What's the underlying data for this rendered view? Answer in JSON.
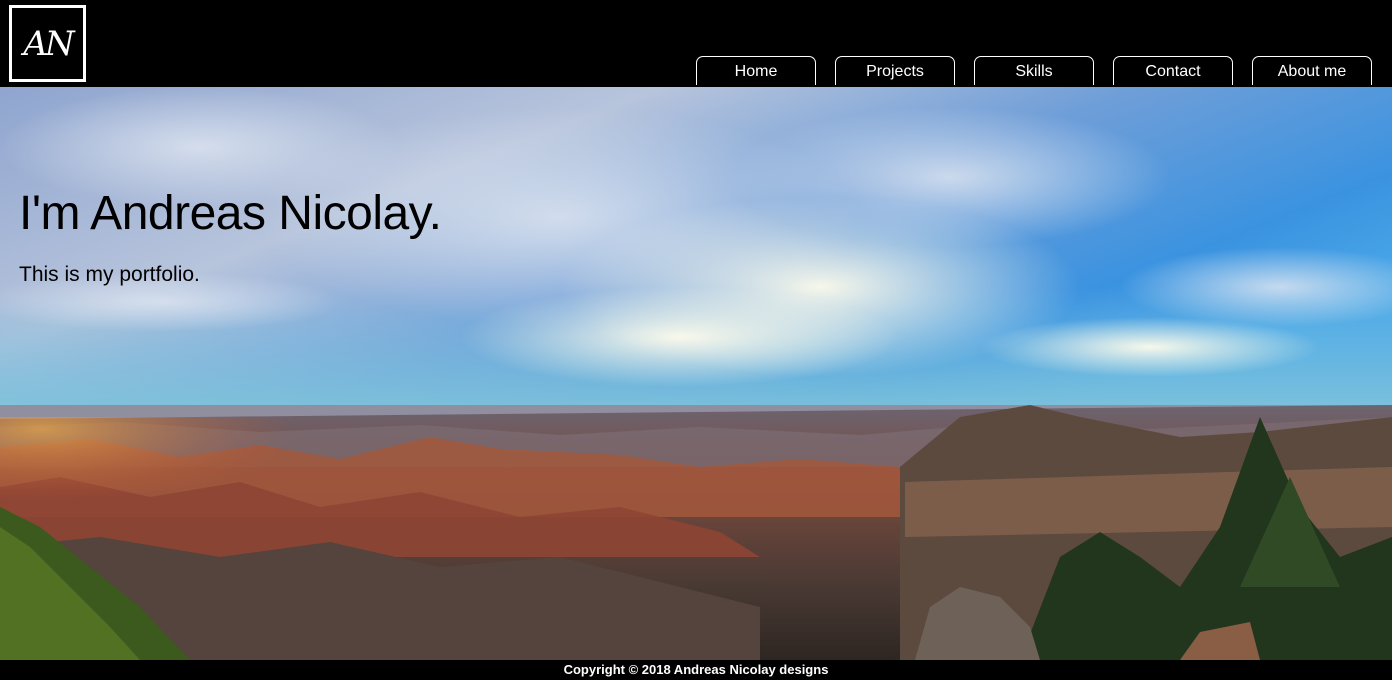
{
  "header": {
    "logo_text": "AN",
    "nav": [
      "Home",
      "Projects",
      "Skills",
      "Contact",
      "About me"
    ]
  },
  "hero": {
    "title": "I'm Andreas Nicolay.",
    "subtitle": "This is my portfolio."
  },
  "footer": {
    "copyright": "Copyright © 2018 Andreas Nicolay designs"
  }
}
